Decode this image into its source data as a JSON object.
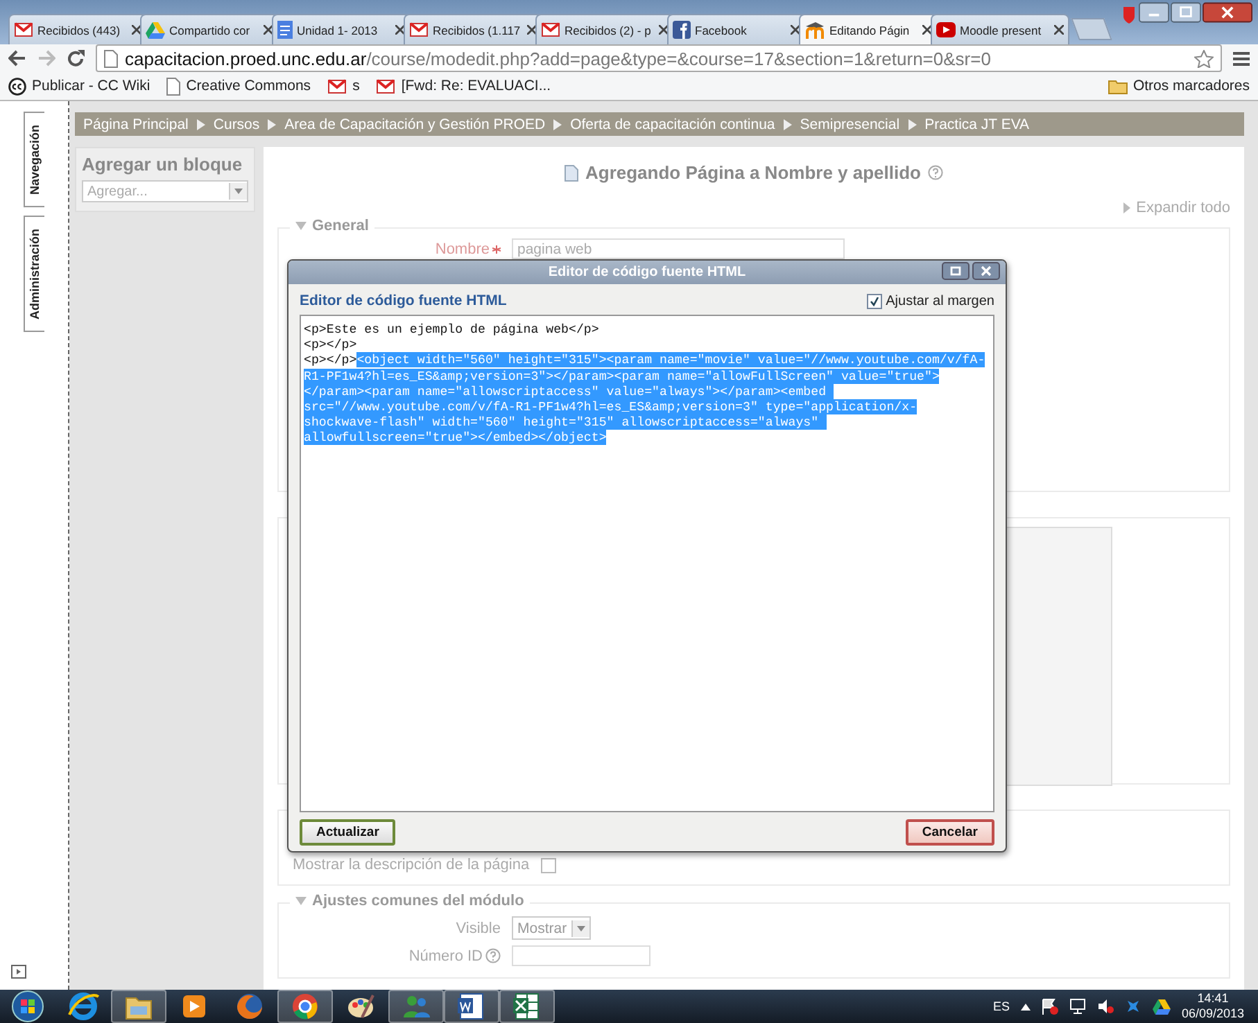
{
  "browser": {
    "tabs": [
      {
        "title": "Recibidos (443)",
        "kind": "mail",
        "selected": false
      },
      {
        "title": "Compartido cor",
        "kind": "drive",
        "selected": false
      },
      {
        "title": "Unidad 1- 2013",
        "kind": "doc",
        "selected": false
      },
      {
        "title": "Recibidos (1.117",
        "kind": "mail",
        "selected": false
      },
      {
        "title": "Recibidos (2) - p",
        "kind": "mail",
        "selected": false
      },
      {
        "title": "Facebook",
        "kind": "facebook",
        "selected": false
      },
      {
        "title": "Editando Págin",
        "kind": "moodle",
        "selected": true
      },
      {
        "title": "Moodle present",
        "kind": "video",
        "selected": false
      }
    ],
    "url_host": "capacitacion.proed.unc.edu.ar",
    "url_path": "/course/modedit.php?add=page&type=&course=17&section=1&return=0&sr=0",
    "bookmarks": [
      {
        "label": "Publicar - CC Wiki",
        "kind": "cc"
      },
      {
        "label": "Creative Commons",
        "kind": "page"
      },
      {
        "label": "s",
        "kind": "mail"
      },
      {
        "label": "[Fwd: Re: EVALUACI...",
        "kind": "mail"
      }
    ],
    "other_bookmarks": "Otros marcadores"
  },
  "side_tabs": [
    "Navegación",
    "Administración"
  ],
  "breadcrumb": [
    "Página Principal",
    "Cursos",
    "Area de Capacitación y Gestión PROED",
    "Oferta de capacitación continua",
    "Semipresencial",
    "Practica JT EVA"
  ],
  "block": {
    "title": "Agregar un bloque",
    "select": "Agregar..."
  },
  "heading": "Agregando Página a Nombre y apellido",
  "expand_all": "Expandir todo",
  "general": {
    "legend": "General",
    "name_label": "Nombre",
    "required": true,
    "name_value": "pagina web"
  },
  "display": {
    "show_description": "Mostrar la descripción de la página",
    "checked": false
  },
  "module": {
    "legend": "Ajustes comunes del módulo",
    "visible_label": "Visible",
    "visible_value": "Mostrar",
    "id_label": "Número ID"
  },
  "dialog": {
    "title": "Editor de código fuente HTML",
    "heading": "Editor de código fuente HTML",
    "wrap_label": "Ajustar al margen",
    "wrap_checked": true,
    "code": [
      {
        "text": "<p>Este es un ejemplo de página web</p>\n<p></p>\n<p></p>",
        "selected": false
      },
      {
        "text": "<object width=\"560\" height=\"315\"><param name=\"movie\" value=\"//www.youtube.com/v/fA-R1-PF1w4?hl=es_ES&amp;version=3\"></param><param name=\"allowFullScreen\" value=\"true\"></param><param name=\"allowscriptaccess\" value=\"always\"></param><embed src=\"//www.youtube.com/v/fA-R1-PF1w4?hl=es_ES&amp;version=3\" type=\"application/x-shockwave-flash\" width=\"560\" height=\"315\" allowscriptaccess=\"always\" allowfullscreen=\"true\"></embed></object>",
        "selected": true
      }
    ],
    "update": "Actualizar",
    "cancel": "Cancelar"
  },
  "taskbar": {
    "apps": [
      {
        "kind": "start",
        "open": false
      },
      {
        "kind": "ie",
        "open": false
      },
      {
        "kind": "explorer",
        "open": true
      },
      {
        "kind": "media",
        "open": false
      },
      {
        "kind": "firefox",
        "open": false
      },
      {
        "kind": "chrome",
        "open": true
      },
      {
        "kind": "paint",
        "open": false
      },
      {
        "kind": "messenger",
        "open": true
      },
      {
        "kind": "word",
        "open": true
      },
      {
        "kind": "excel",
        "open": true
      }
    ],
    "language": "ES",
    "time": "14:41",
    "date": "06/09/2013"
  }
}
